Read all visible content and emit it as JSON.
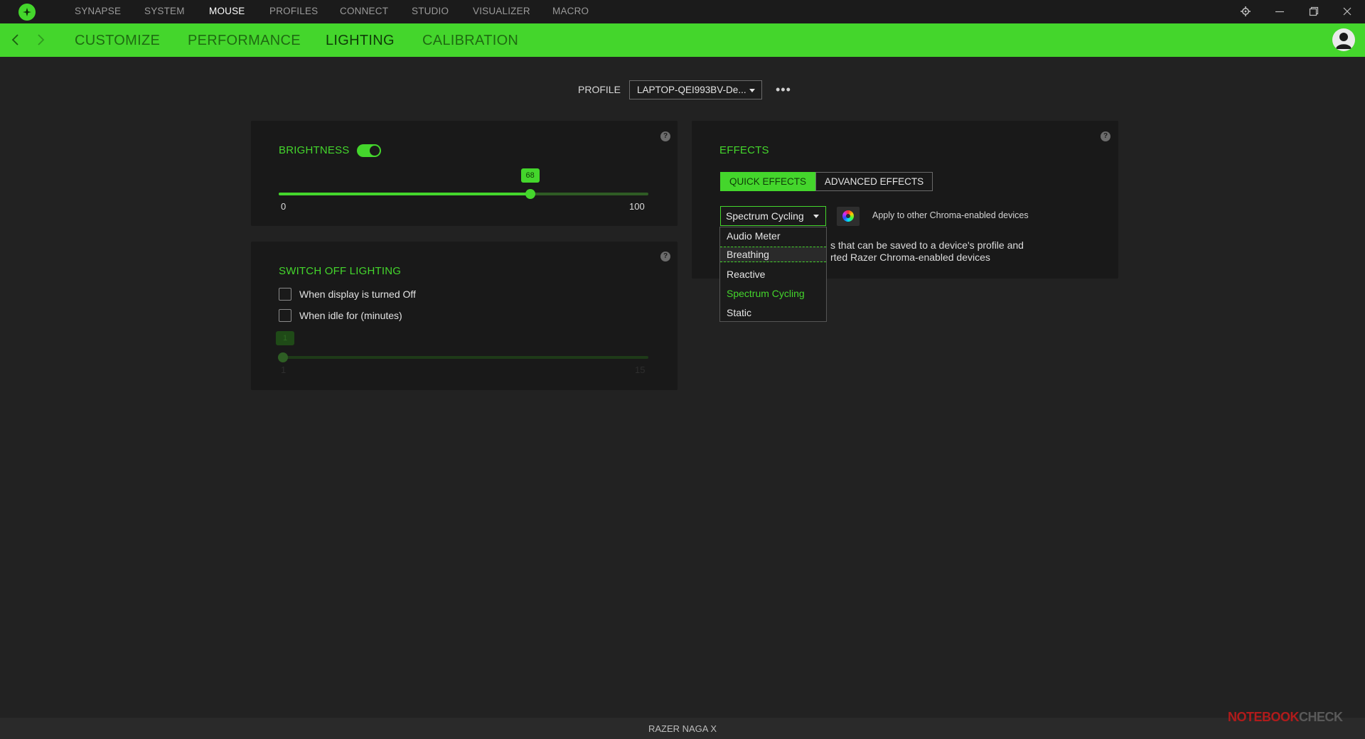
{
  "top_nav": {
    "items": [
      "SYNAPSE",
      "SYSTEM",
      "MOUSE",
      "PROFILES",
      "CONNECT",
      "STUDIO",
      "VISUALIZER",
      "MACRO"
    ],
    "active": "MOUSE"
  },
  "sub_nav": {
    "items": [
      "CUSTOMIZE",
      "PERFORMANCE",
      "LIGHTING",
      "CALIBRATION"
    ],
    "active": "LIGHTING"
  },
  "profile": {
    "label": "PROFILE",
    "value": "LAPTOP-QEI993BV-De..."
  },
  "brightness": {
    "title": "BRIGHTNESS",
    "enabled": true,
    "value": "68",
    "value_num": 68,
    "min": "0",
    "max": "100"
  },
  "switch_off": {
    "title": "SWITCH OFF LIGHTING",
    "display_off_label": "When display is turned Off",
    "idle_label": "When idle for (minutes)",
    "idle_value": "1",
    "idle_min": "1",
    "idle_max": "15"
  },
  "effects": {
    "title": "EFFECTS",
    "tab_quick": "QUICK EFFECTS",
    "tab_advanced": "ADVANCED EFFECTS",
    "selected": "Spectrum Cycling",
    "apply_label": "Apply to other Chroma-enabled devices",
    "desc_line1": "s that can be saved to a device's profile and",
    "desc_line2": "rted Razer Chroma-enabled devices",
    "options": [
      "Audio Meter",
      "Breathing",
      "Reactive",
      "Spectrum Cycling",
      "Static"
    ],
    "hovered": "Breathing"
  },
  "footer": {
    "device": "RAZER NAGA X"
  },
  "watermark": {
    "text_a": "NOTEBOOK",
    "text_b": "CHECK"
  },
  "colors": {
    "accent": "#44d62c",
    "background": "#222222",
    "panel": "#191919"
  }
}
